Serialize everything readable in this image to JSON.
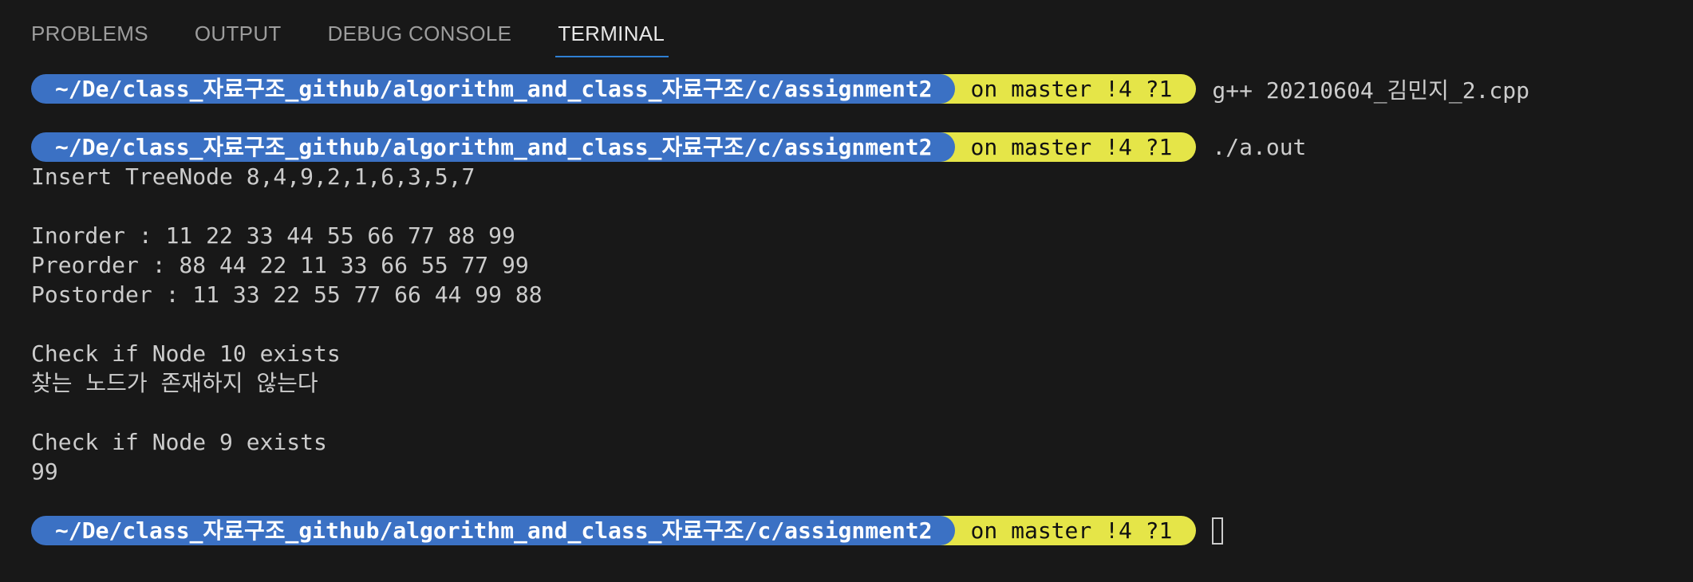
{
  "tabs": [
    {
      "label": "PROBLEMS"
    },
    {
      "label": "OUTPUT"
    },
    {
      "label": "DEBUG CONSOLE"
    },
    {
      "label": "TERMINAL",
      "active": true
    }
  ],
  "prompt": {
    "path": "~/De/class_자료구조_github/algorithm_and_class_자료구조/c/assignment2",
    "git": "on master !4 ?1"
  },
  "commands": {
    "first": "g++ 20210604_김민지_2.cpp",
    "second": "./a.out"
  },
  "output": {
    "insert": "Insert TreeNode 8,4,9,2,1,6,3,5,7",
    "inorder": "Inorder : 11 22 33 44 55 66 77 88 99",
    "preorder": "Preorder : 88 44 22 11 33 66 55 77 99",
    "postorder": "Postorder : 11 33 22 55 77 66 44 99 88",
    "check10": "Check if Node 10 exists",
    "not_found": "찾는 노드가 존재하지 않는다",
    "check9": "Check if Node 9 exists",
    "found": "99"
  },
  "colors": {
    "background": "#181818",
    "path_segment": "#3b71c4",
    "git_segment": "#e5e548",
    "active_tab_underline": "#2f7fd3"
  }
}
